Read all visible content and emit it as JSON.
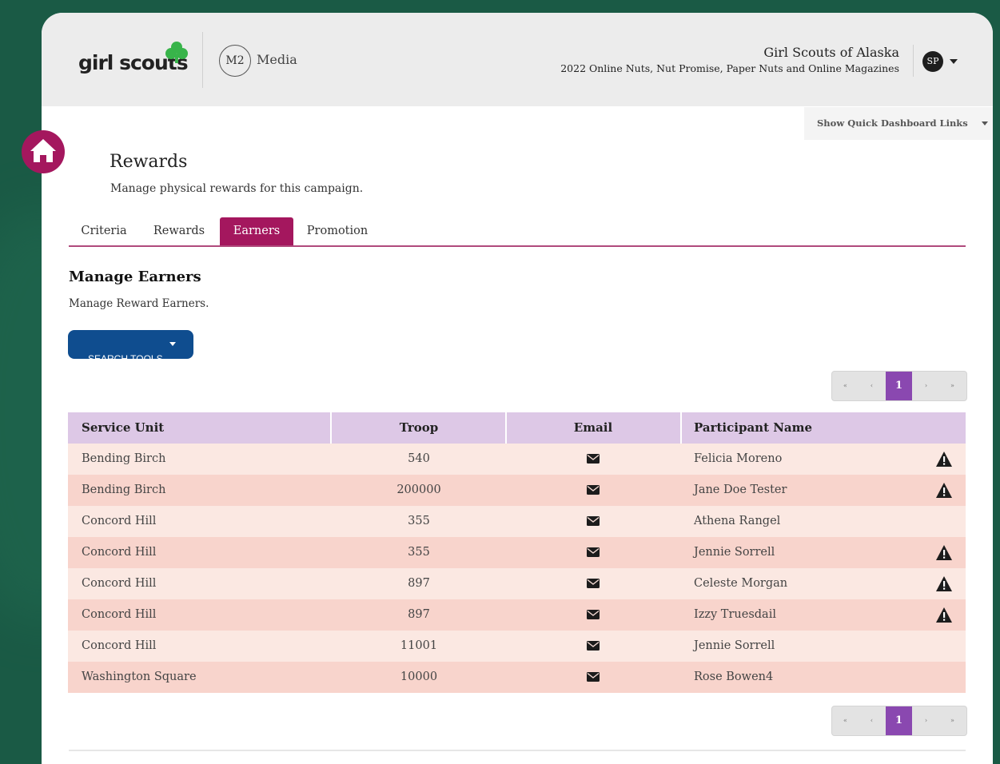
{
  "header": {
    "brand": "girl scouts",
    "partner_mark": "M2",
    "partner_name": "Media",
    "org_name": "Girl Scouts of Alaska",
    "campaign": "2022 Online Nuts, Nut Promise, Paper Nuts and Online Magazines",
    "avatar_initials": "SP",
    "quick_links_label": "Show Quick Dashboard Links"
  },
  "page": {
    "title": "Rewards",
    "subtitle": "Manage physical rewards for this campaign."
  },
  "tabs": [
    {
      "label": "Criteria",
      "active": false
    },
    {
      "label": "Rewards",
      "active": false
    },
    {
      "label": "Earners",
      "active": true
    },
    {
      "label": "Promotion",
      "active": false
    }
  ],
  "section": {
    "title": "Manage Earners",
    "subtitle": "Manage Reward Earners.",
    "search_button": "SEARCH TOOLS"
  },
  "pagination": {
    "current_page": "1",
    "first": "«",
    "prev": "‹",
    "next": "›",
    "last": "»"
  },
  "table": {
    "columns": [
      "Service Unit",
      "Troop",
      "Email",
      "Participant Name"
    ],
    "rows": [
      {
        "service_unit": "Bending Birch",
        "troop": "540",
        "participant": "Felicia Moreno",
        "warning": true
      },
      {
        "service_unit": "Bending Birch",
        "troop": "200000",
        "participant": "Jane Doe Tester",
        "warning": true
      },
      {
        "service_unit": "Concord Hill",
        "troop": "355",
        "participant": "Athena Rangel",
        "warning": false
      },
      {
        "service_unit": "Concord Hill",
        "troop": "355",
        "participant": "Jennie Sorrell",
        "warning": true
      },
      {
        "service_unit": "Concord Hill",
        "troop": "897",
        "participant": "Celeste Morgan",
        "warning": true
      },
      {
        "service_unit": "Concord Hill",
        "troop": "897",
        "participant": "Izzy Truesdail",
        "warning": true
      },
      {
        "service_unit": "Concord Hill",
        "troop": "11001",
        "participant": "Jennie Sorrell",
        "warning": false
      },
      {
        "service_unit": "Washington Square",
        "troop": "10000",
        "participant": "Rose Bowen4",
        "warning": false
      }
    ]
  },
  "colors": {
    "accent": "#a4175e",
    "search_button": "#0f4d8f",
    "pager_active": "#8a48b0",
    "table_header": "#ddc8e6",
    "row_light": "#fbe8e2",
    "row_dark": "#f8d4cc",
    "frame": "#1a5a45"
  }
}
